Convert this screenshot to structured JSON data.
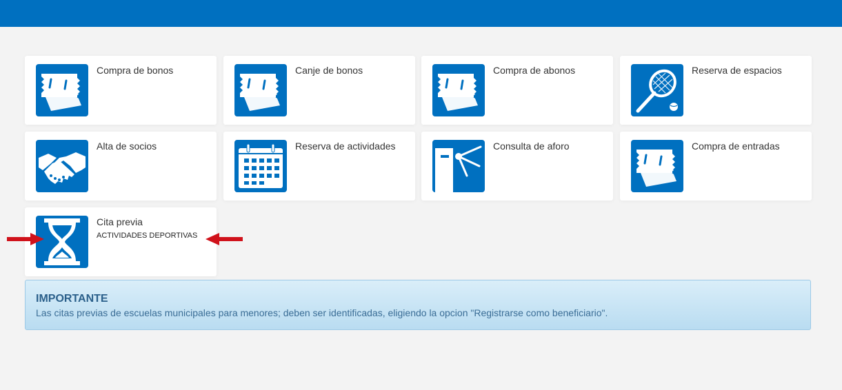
{
  "header": {
    "bar_color": "#0070c0"
  },
  "cards": [
    {
      "title": "Compra de bonos",
      "icon": "tickets-icon"
    },
    {
      "title": "Canje de bonos",
      "icon": "tickets-icon"
    },
    {
      "title": "Compra de abonos",
      "icon": "tickets-icon"
    },
    {
      "title": "Reserva de espacios",
      "icon": "tennis-racket-icon"
    },
    {
      "title": "Alta de socios",
      "icon": "handshake-icon"
    },
    {
      "title": "Reserva de actividades",
      "icon": "calendar-icon"
    },
    {
      "title": "Consulta de aforo",
      "icon": "turnstile-icon"
    },
    {
      "title": "Compra de entradas",
      "icon": "tickets-icon"
    },
    {
      "title": "Cita previa",
      "subtitle": "ACTIVIDADES DEPORTIVAS",
      "icon": "hourglass-icon"
    }
  ],
  "annotations": {
    "arrow_color": "#d0121b",
    "arrow_icon": "red-arrow-icon"
  },
  "notice": {
    "title": "IMPORTANTE",
    "text": "Las citas previas de escuelas municipales para menores; deben ser identificadas, eligiendo la opcion \"Registrarse como beneficiario\"."
  }
}
